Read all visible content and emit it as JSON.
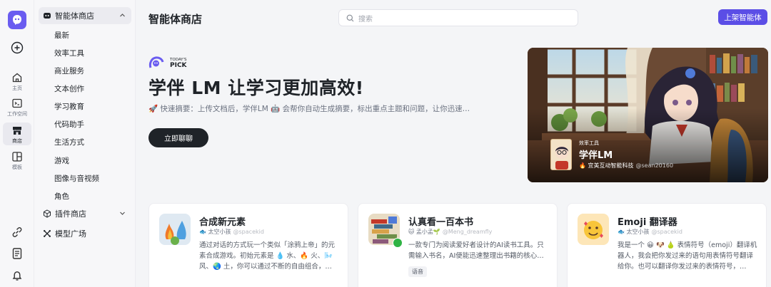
{
  "rail": {
    "items": [
      {
        "label": "主页",
        "icon": "home-icon"
      },
      {
        "label": "工作空间",
        "icon": "terminal-icon"
      },
      {
        "label": "商店",
        "icon": "store-icon"
      },
      {
        "label": "模板",
        "icon": "template-icon"
      }
    ]
  },
  "sidebar": {
    "agent_store": "智能体商店",
    "categories": [
      "最新",
      "效率工具",
      "商业服务",
      "文本创作",
      "学习教育",
      "代码助手",
      "生活方式",
      "游戏",
      "图像与音视频",
      "角色"
    ],
    "plugin_store": "插件商店",
    "model_plaza": "模型广场"
  },
  "header": {
    "title": "智能体商店",
    "search_placeholder": "搜索",
    "publish_button": "上架智能体"
  },
  "hero": {
    "pick_small": "TODAY'S",
    "pick_big": "PICK",
    "title": "学伴 LM 让学习更加高效!",
    "description": "🚀 快速摘要：上传文档后，学伴LM 🤖 会帮你自动生成摘要，标出重点主题和问题，让你迅速…",
    "chat_button": "立即聊聊"
  },
  "featured": {
    "tag": "效率工具",
    "name": "学伴LM",
    "author": "🔥 宜美互动智能科技",
    "handle": "@sean20160"
  },
  "cards": [
    {
      "name": "合成新元素",
      "author": "🐟 太空小孩",
      "handle": "@spacekid",
      "description": "通过对话的方式玩一个类似「涂鸦上帝」的元素合成游戏。初始元素是 💧 水、🔥 火、🌬️ 风、🌏 土，你可以通过不断的自由组合，…"
    },
    {
      "name": "认真看一百本书",
      "author": "🐱 孟小孟🌱",
      "handle": "@Meng_dreamfly",
      "description": "一款专门为阅读爱好者设计的AI读书工具。只需输入书名，AI便能迅速整理出书籍的核心…",
      "tag": "语音"
    },
    {
      "name": "Emoji 翻译器",
      "author": "🐟 太空小孩",
      "handle": "@spacekid",
      "description": "我是一个 😀 🐶 🍐 表情符号（emoji）翻译机器人，我会把你发过来的语句用表情符号翻译给你。也可以翻译你发过来的表情符号，…"
    }
  ],
  "colors": {
    "accent": "#5b4ee6",
    "dark_button": "#1f2328"
  }
}
